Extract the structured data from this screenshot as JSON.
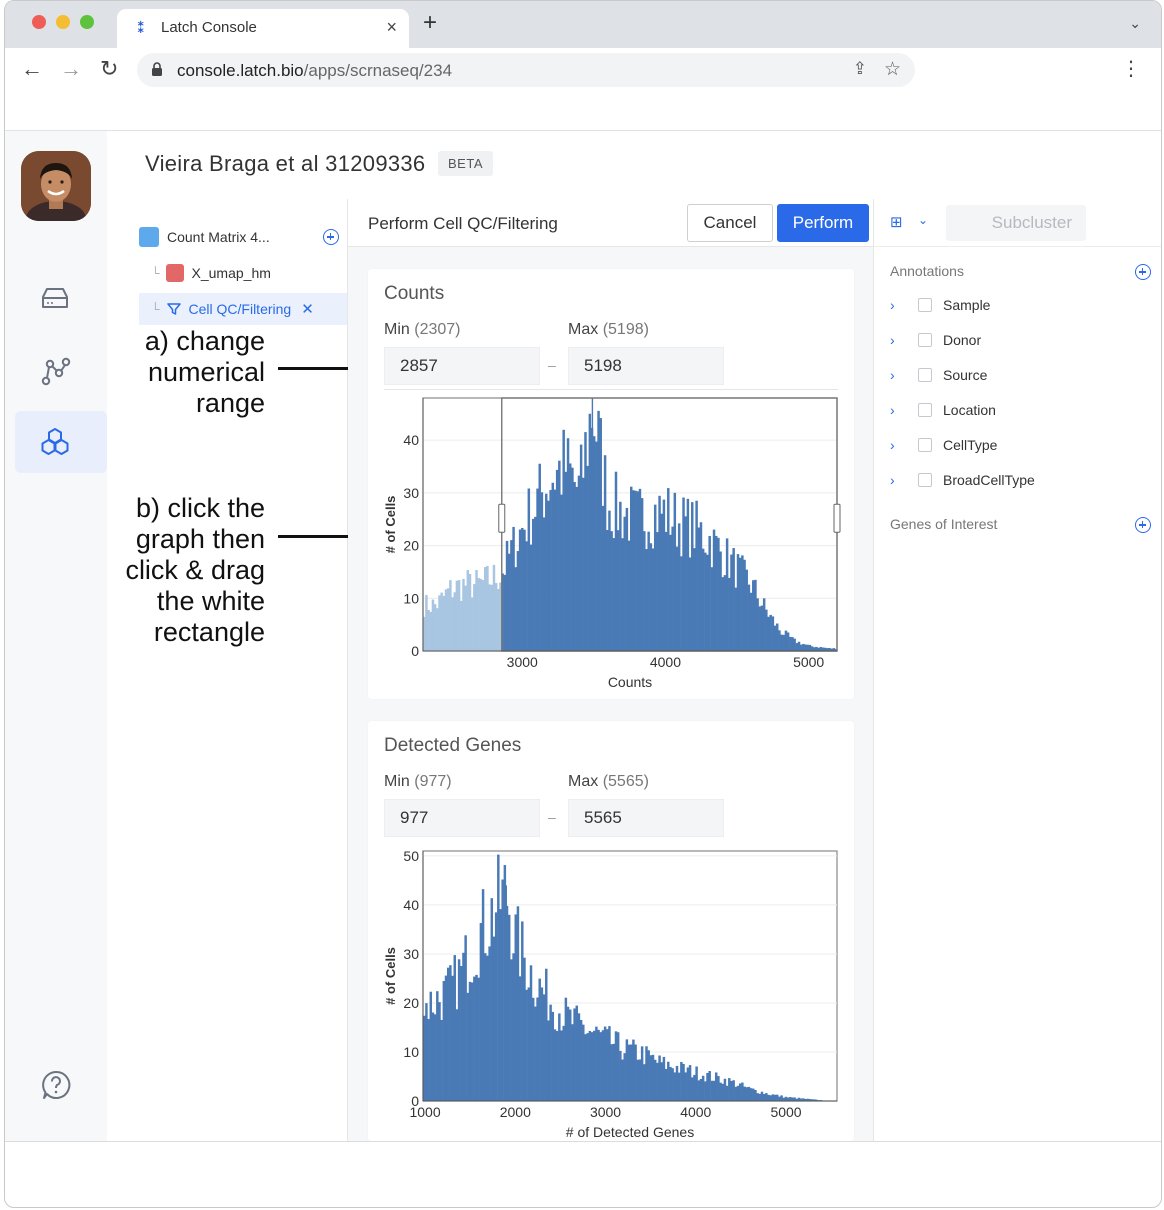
{
  "browser": {
    "tab_title": "Latch Console",
    "tab_close": "×",
    "new_tab": "+",
    "url_host": "console.latch.bio",
    "url_path": "/apps/scrnaseq/234"
  },
  "page": {
    "title": "Vieira Braga et al 31209336",
    "badge": "BETA"
  },
  "tree": {
    "items": [
      {
        "label": "Count Matrix 4..."
      },
      {
        "label": "X_umap_hm"
      },
      {
        "label": "Cell QC/Filtering"
      }
    ],
    "remove_glyph": "✕"
  },
  "annotations": {
    "a_lines": [
      "a) change",
      "numerical",
      "range"
    ],
    "b_lines": [
      "b) click the",
      "graph then",
      "click & drag",
      "the white",
      "rectangle"
    ]
  },
  "main": {
    "title": "Perform Cell QC/Filtering",
    "cancel_label": "Cancel",
    "perform_label": "Perform"
  },
  "counts_card": {
    "title": "Counts",
    "min_label": "Min",
    "min_paren": "(2307)",
    "max_label": "Max",
    "max_paren": "(5198)",
    "min_value": "2857",
    "max_value": "5198",
    "dash": "–"
  },
  "genes_card": {
    "title": "Detected Genes",
    "min_label": "Min",
    "min_paren": "(977)",
    "max_label": "Max",
    "max_paren": "(5565)",
    "min_value": "977",
    "max_value": "5565",
    "dash": "–"
  },
  "chart_data": [
    {
      "type": "bar",
      "xlabel": "Counts",
      "ylabel": "# of Cells",
      "xlim": [
        2307,
        5198
      ],
      "ylim": [
        0,
        48
      ],
      "x_ticks": [
        3000,
        4000,
        5000
      ],
      "y_ticks": [
        0,
        10,
        20,
        30,
        40
      ],
      "selection": [
        2857,
        5198
      ],
      "series": [
        {
          "values": [
            {
              "x": 2400,
              "y": 9
            },
            {
              "x": 2500,
              "y": 12
            },
            {
              "x": 2600,
              "y": 13
            },
            {
              "x": 2700,
              "y": 13
            },
            {
              "x": 2850,
              "y": 15
            },
            {
              "x": 2900,
              "y": 18
            },
            {
              "x": 3000,
              "y": 24
            },
            {
              "x": 3100,
              "y": 29
            },
            {
              "x": 3200,
              "y": 34
            },
            {
              "x": 3300,
              "y": 36
            },
            {
              "x": 3400,
              "y": 31
            },
            {
              "x": 3490,
              "y": 48
            },
            {
              "x": 3600,
              "y": 29
            },
            {
              "x": 3700,
              "y": 27
            },
            {
              "x": 3800,
              "y": 26
            },
            {
              "x": 3900,
              "y": 27
            },
            {
              "x": 4000,
              "y": 27
            },
            {
              "x": 4100,
              "y": 25
            },
            {
              "x": 4200,
              "y": 24
            },
            {
              "x": 4300,
              "y": 22
            },
            {
              "x": 4400,
              "y": 19
            },
            {
              "x": 4500,
              "y": 16
            },
            {
              "x": 4600,
              "y": 13
            },
            {
              "x": 4700,
              "y": 8
            },
            {
              "x": 4800,
              "y": 4
            },
            {
              "x": 4900,
              "y": 2
            },
            {
              "x": 5000,
              "y": 1
            },
            {
              "x": 5150,
              "y": 0.5
            }
          ]
        }
      ],
      "colors": {
        "bar": "#4a7ab5",
        "bar_unselected": "#a8c5e2"
      }
    },
    {
      "type": "bar",
      "xlabel": "# of Detected Genes",
      "ylabel": "# of Cells",
      "xlim": [
        977,
        5565
      ],
      "ylim": [
        0,
        51
      ],
      "x_ticks": [
        1000,
        2000,
        3000,
        4000,
        5000
      ],
      "y_ticks": [
        0,
        10,
        20,
        30,
        40,
        50
      ],
      "series": [
        {
          "values": [
            {
              "x": 1000,
              "y": 20
            },
            {
              "x": 1100,
              "y": 21
            },
            {
              "x": 1200,
              "y": 22
            },
            {
              "x": 1300,
              "y": 24
            },
            {
              "x": 1400,
              "y": 27
            },
            {
              "x": 1500,
              "y": 31
            },
            {
              "x": 1600,
              "y": 35
            },
            {
              "x": 1700,
              "y": 38
            },
            {
              "x": 1800,
              "y": 41
            },
            {
              "x": 1900,
              "y": 44
            },
            {
              "x": 2000,
              "y": 34
            },
            {
              "x": 2100,
              "y": 30
            },
            {
              "x": 2200,
              "y": 26
            },
            {
              "x": 2300,
              "y": 23
            },
            {
              "x": 2400,
              "y": 21
            },
            {
              "x": 2500,
              "y": 19
            },
            {
              "x": 2600,
              "y": 17
            },
            {
              "x": 2800,
              "y": 15
            },
            {
              "x": 3000,
              "y": 13
            },
            {
              "x": 3200,
              "y": 11
            },
            {
              "x": 3400,
              "y": 10
            },
            {
              "x": 3600,
              "y": 8
            },
            {
              "x": 3800,
              "y": 7
            },
            {
              "x": 4000,
              "y": 6
            },
            {
              "x": 4200,
              "y": 5
            },
            {
              "x": 4400,
              "y": 4
            },
            {
              "x": 4600,
              "y": 2.5
            },
            {
              "x": 4800,
              "y": 1.5
            },
            {
              "x": 5000,
              "y": 0.8
            },
            {
              "x": 5300,
              "y": 0.3
            },
            {
              "x": 5500,
              "y": 0
            }
          ]
        }
      ],
      "colors": {
        "bar": "#4a7ab5"
      }
    }
  ],
  "right_panel": {
    "subcluster_label": "Subcluster",
    "annotations_label": "Annotations",
    "annotation_items": [
      "Sample",
      "Donor",
      "Source",
      "Location",
      "CellType",
      "BroadCellType"
    ],
    "genes_label": "Genes of Interest"
  },
  "icons": {
    "chevron_right": "›",
    "chevron_down": "⌄",
    "tab_menu": "⌄",
    "back": "←",
    "forward": "→",
    "reload": "↻",
    "star": "☆",
    "share": "⇪",
    "kebab": "⋮",
    "layer": "⊞",
    "favicon": "⁑"
  },
  "colors": {
    "accent": "#2a6ae8",
    "bar": "#4a7ab5",
    "bar_unselected": "#a8c5e2"
  }
}
